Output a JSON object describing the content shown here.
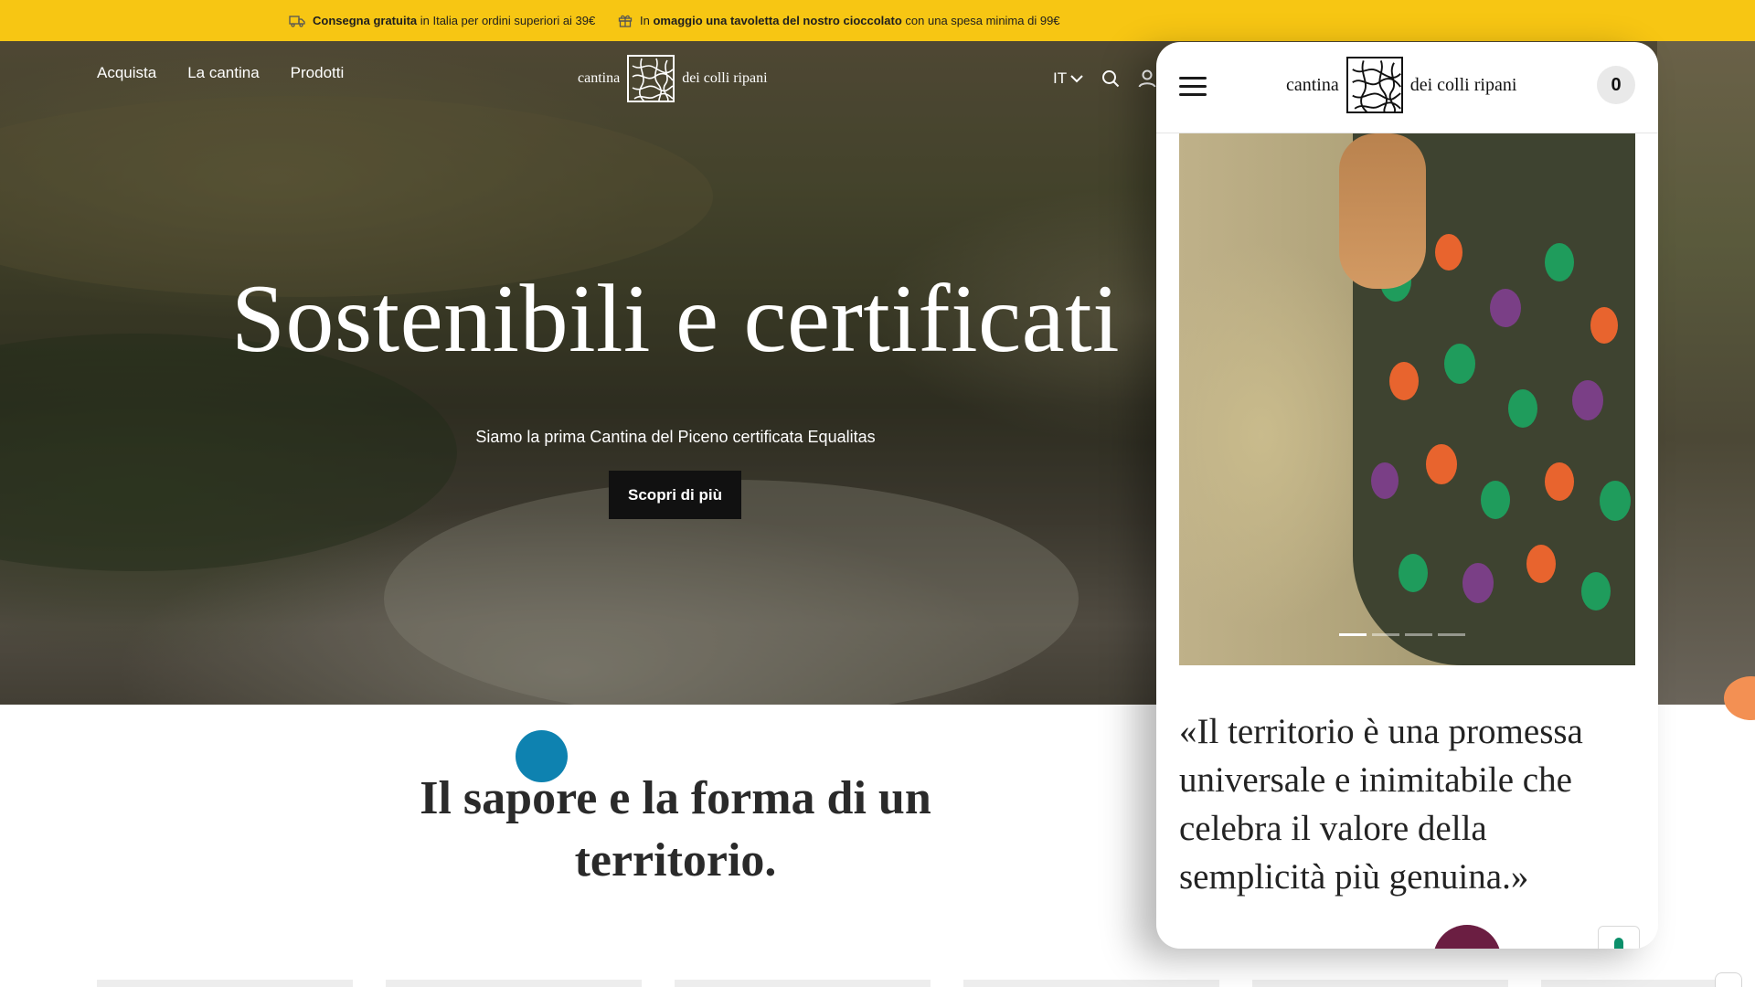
{
  "announcement": {
    "shipping_bold": "Consegna gratuita",
    "shipping_text": "in Italia per ordini superiori ai 39€",
    "gift_prefix": "In",
    "gift_bold": "omaggio una tavoletta del nostro cioccolato",
    "gift_text": "con una spesa minima di 99€",
    "shipping_icon": "truck-icon",
    "gift_icon": "gift-icon"
  },
  "nav": {
    "links": [
      "Acquista",
      "La cantina",
      "Prodotti"
    ],
    "language": "IT",
    "search_icon": "search-icon",
    "account_icon": "user-icon"
  },
  "logo": {
    "left": "cantina",
    "right": "dei colli ripani"
  },
  "hero": {
    "title": "Sostenibili e certificati",
    "subtitle": "Siamo la prima Cantina del Piceno certificata Equalitas",
    "cta": "Scopri di più"
  },
  "section": {
    "title": "Il sapore e la forma di un territorio."
  },
  "mobile": {
    "cart_count": "0",
    "quote": "«Il territorio è una promessa universale e inimitabile che celebra il valore della semplicità più genuina.»",
    "carousel_active": 1,
    "carousel_total": 4
  },
  "colors": {
    "announcement_bg": "#f7c613",
    "cta_bg": "#111111",
    "accent_blue": "#0e82b0",
    "accent_plum": "#6b1e42",
    "accent_orange": "#f39053"
  }
}
